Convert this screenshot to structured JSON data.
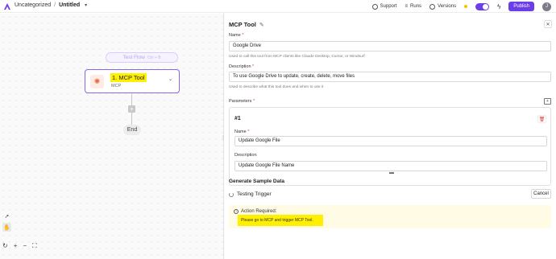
{
  "header": {
    "breadcrumb_folder": "Uncategorized",
    "breadcrumb_sep": "/",
    "flow_name": "Untitled",
    "support_label": "Support",
    "runs_label": "Runs",
    "versions_label": "Versions",
    "publish_label": "Publish",
    "avatar_initial": "J",
    "toggle_on": true,
    "accent_color": "#6c3ee8"
  },
  "canvas": {
    "test_flow_label": "Test Flow",
    "test_flow_shortcut": "Ctrl + B",
    "node": {
      "title": "1. MCP Tool",
      "subtitle": "MCP"
    },
    "add_symbol": "+",
    "end_label": "End"
  },
  "panel": {
    "title": "MCP Tool",
    "name": {
      "label": "Name",
      "value": "Google Drive",
      "help": "Used to call this tool from MCP clients like Claude Desktop, Cursor, or Windsurf"
    },
    "description": {
      "label": "Description",
      "value": "To use Google Drive to update, create, delete, move files",
      "help": "Used to describe what this tool does and when to use it"
    },
    "parameters": {
      "label": "Parameters",
      "items": [
        {
          "index": "#1",
          "name_label": "Name",
          "name_value": "Update Google File",
          "description_label": "Description",
          "description_value": "Update Google File Name"
        }
      ]
    },
    "sample": {
      "title": "Generate Sample Data",
      "testing_label": "Testing Trigger",
      "cancel_label": "Cancel",
      "alert_title": "Action Required:",
      "alert_message": "Please go to MCP and trigger MCP Tool."
    }
  }
}
